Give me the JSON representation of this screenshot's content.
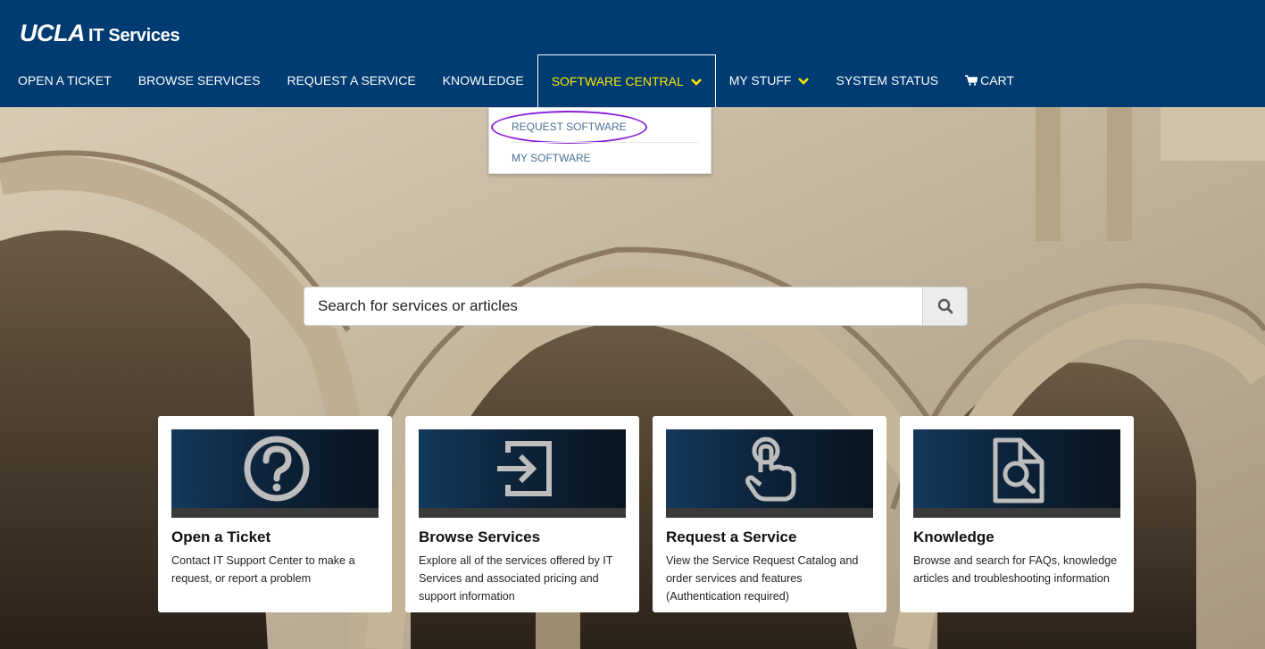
{
  "header": {
    "logo_main": "UCLA",
    "logo_sub": "IT Services"
  },
  "nav": {
    "items": [
      {
        "label": "OPEN A TICKET"
      },
      {
        "label": "BROWSE SERVICES"
      },
      {
        "label": "REQUEST A SERVICE"
      },
      {
        "label": "KNOWLEDGE"
      },
      {
        "label": "SOFTWARE CENTRAL"
      },
      {
        "label": "MY STUFF"
      },
      {
        "label": "SYSTEM STATUS"
      },
      {
        "label": "CART"
      }
    ]
  },
  "dropdown": {
    "items": [
      {
        "label": "REQUEST SOFTWARE"
      },
      {
        "label": "MY SOFTWARE"
      }
    ]
  },
  "search": {
    "placeholder": "Search for services or articles"
  },
  "cards": [
    {
      "title": "Open a Ticket",
      "description": "Contact IT Support Center to make a request, or report a problem",
      "icon": "question-icon"
    },
    {
      "title": "Browse Services",
      "description": "Explore all of the services offered by IT Services and associated pricing and support information",
      "icon": "enter-icon"
    },
    {
      "title": "Request a Service",
      "description": "View the Service Request Catalog and order services and features (Authentication required)",
      "icon": "hand-pointer-icon"
    },
    {
      "title": "Knowledge",
      "description": "Browse and search for FAQs, knowledge articles and troubleshooting information",
      "icon": "document-search-icon"
    }
  ],
  "colors": {
    "header_bg": "#003b71",
    "active_nav": "#ffe800",
    "dropdown_link": "#4a6f94",
    "highlight_circle": "#8a1fe0"
  }
}
